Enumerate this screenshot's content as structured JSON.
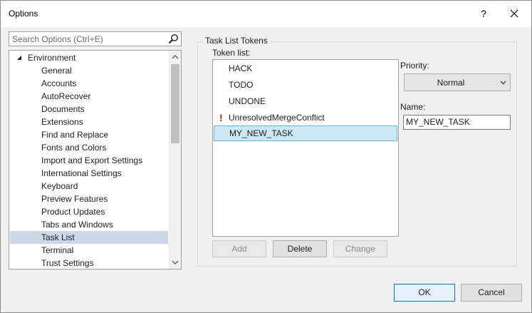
{
  "window": {
    "title": "Options",
    "help_label": "?"
  },
  "search": {
    "placeholder": "Search Options (Ctrl+E)"
  },
  "tree": {
    "root_label": "Environment",
    "items": [
      {
        "label": "General"
      },
      {
        "label": "Accounts"
      },
      {
        "label": "AutoRecover"
      },
      {
        "label": "Documents"
      },
      {
        "label": "Extensions"
      },
      {
        "label": "Find and Replace"
      },
      {
        "label": "Fonts and Colors"
      },
      {
        "label": "Import and Export Settings"
      },
      {
        "label": "International Settings"
      },
      {
        "label": "Keyboard"
      },
      {
        "label": "Preview Features"
      },
      {
        "label": "Product Updates"
      },
      {
        "label": "Tabs and Windows"
      },
      {
        "label": "Task List",
        "selected": true
      },
      {
        "label": "Terminal"
      },
      {
        "label": "Trust Settings"
      }
    ]
  },
  "panel": {
    "group_title": "Task List Tokens",
    "token_list_label": "Token list:",
    "tokens": [
      {
        "text": "HACK"
      },
      {
        "text": "TODO"
      },
      {
        "text": "UNDONE"
      },
      {
        "text": "UnresolvedMergeConflict",
        "warning": "!"
      },
      {
        "text": "MY_NEW_TASK",
        "selected": true
      }
    ],
    "buttons": {
      "add": "Add",
      "delete": "Delete",
      "change": "Change"
    },
    "priority_label": "Priority:",
    "priority_value": "Normal",
    "name_label": "Name:",
    "name_value": "MY_NEW_TASK"
  },
  "footer": {
    "ok": "OK",
    "cancel": "Cancel"
  },
  "colors": {
    "selection": "#ccd8e8",
    "token_selection": "#cce8f5",
    "warning": "#e51400",
    "default_button_border": "#0078d7"
  }
}
